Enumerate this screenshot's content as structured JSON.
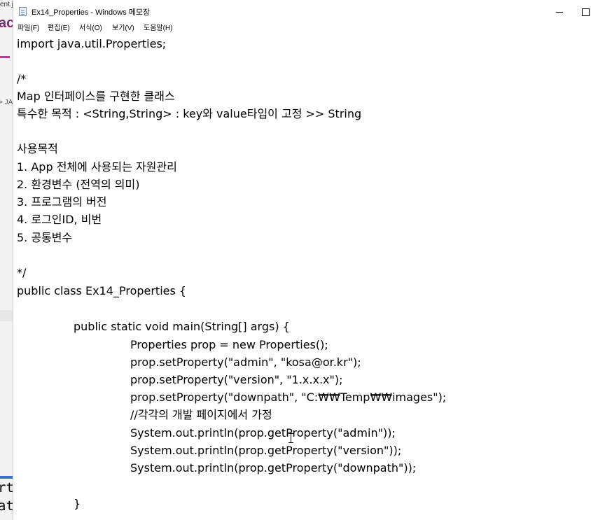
{
  "background": {
    "tab_text": "ent.j",
    "brand_text": "ac",
    "crumb_text": "> JA",
    "code_line_1": "rt",
    "code_line_2": "at"
  },
  "window": {
    "title": "Ex14_Properties - Windows 메모장",
    "icon": "notepad-icon",
    "controls": [
      "minimize",
      "maximize"
    ]
  },
  "menu": {
    "items": [
      "파일(F)",
      "편집(E)",
      "서식(O)",
      "보기(V)",
      "도움말(H)"
    ]
  },
  "editor": {
    "lines": [
      "import java.util.Properties;",
      "",
      "/*",
      "Map 인터페이스를 구현한 클래스",
      "특수한 목적 : <String,String> : key와 value타입이 고정 >> String",
      "",
      "사용목적",
      "1. App 전체에 사용되는 자원관리",
      "2. 환경변수 (전역의 의미)",
      "3. 프로그램의 버전",
      "4. 로그인ID, 비번",
      "5. 공통변수",
      "",
      "*/",
      "public class Ex14_Properties {",
      "",
      "\t\tpublic static void main(String[] args) {",
      "\t\t\t\tProperties prop = new Properties();",
      "\t\t\t\tprop.setProperty(\"admin\", \"kosa@or.kr\");",
      "\t\t\t\tprop.setProperty(\"version\", \"1.x.x.x\");",
      "\t\t\t\tprop.setProperty(\"downpath\", \"C:₩₩Temp₩₩images\");",
      "\t\t\t\t//각각의 개발 페이지에서 가정",
      "\t\t\t\tSystem.out.println(prop.getProperty(\"admin\"));",
      "\t\t\t\tSystem.out.println(prop.getProperty(\"version\"));",
      "\t\t\t\tSystem.out.println(prop.getProperty(\"downpath\"));",
      "",
      "\t\t}"
    ]
  }
}
